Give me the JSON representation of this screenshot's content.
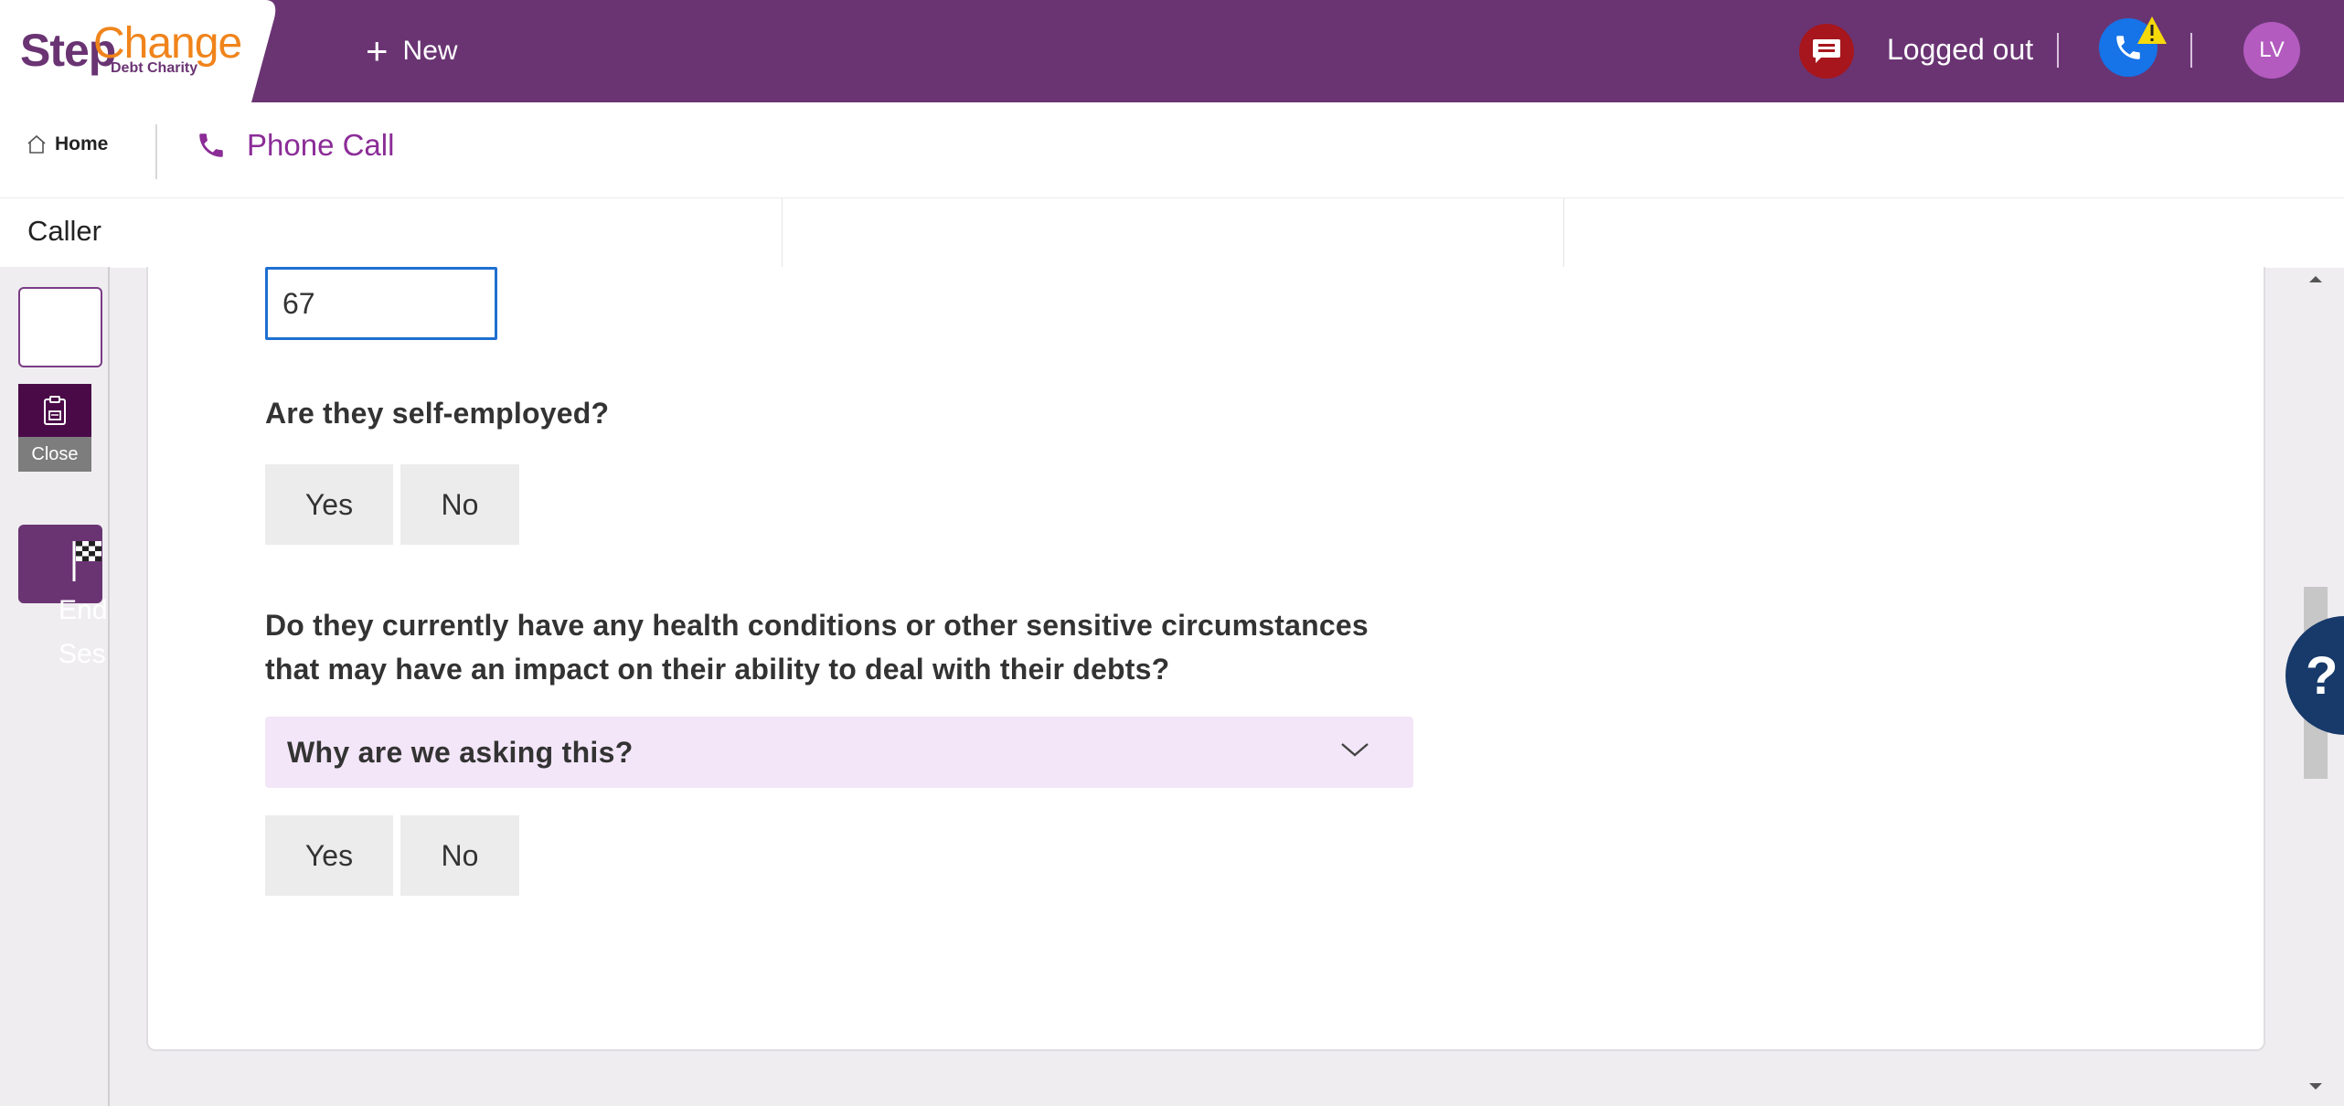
{
  "header": {
    "logo": {
      "step": "Step",
      "change": "Change",
      "subtitle": "Debt Charity"
    },
    "new_label": "New",
    "status_label": "Logged out",
    "avatar_initials": "LV",
    "colors": {
      "brand_purple": "#6a3473",
      "logo_orange": "#f0841b",
      "chat_red": "#a6161c",
      "phone_blue": "#1673e8",
      "warning_yellow": "#f5d90a",
      "avatar": "#b35bbf"
    },
    "icons": [
      "plus-icon",
      "chat-icon",
      "phone-status-icon",
      "warning-icon"
    ]
  },
  "tabs": {
    "home_label": "Home",
    "active_tab_label": "Phone Call",
    "icons": [
      "home-icon",
      "phone-icon"
    ]
  },
  "caller": {
    "label": "Caller"
  },
  "left_rail": {
    "close_label": "Close",
    "end_session_label": [
      "End",
      "Session"
    ],
    "icons": [
      "clipboard-icon",
      "checkered-flag-icon"
    ]
  },
  "form": {
    "age_value": "67",
    "question_self_employed": "Are they self-employed?",
    "question_health_line1": "Do they currently have any health conditions or other sensitive circumstances",
    "question_health_line2": "that may have an impact on their ability to deal with their debts?",
    "why_asking_label": "Why are we asking this?",
    "yes_label": "Yes",
    "no_label": "No",
    "input_focus_color": "#1f6fd1",
    "accordion_bg": "#f3e6f8"
  },
  "help": {
    "label": "?",
    "color": "#173a6b"
  }
}
